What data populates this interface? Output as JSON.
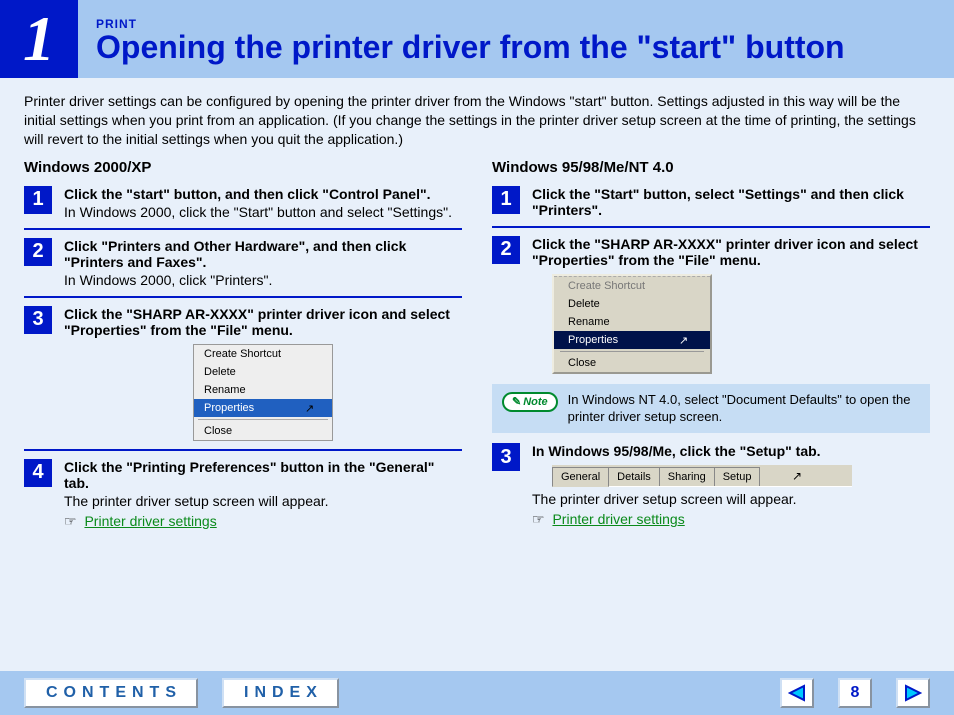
{
  "header": {
    "step_number": "1",
    "section_label": "PRINT",
    "title": "Opening the printer driver from the \"start\" button"
  },
  "intro_text": "Printer driver settings can be configured by opening the printer driver from the Windows \"start\" button. Settings adjusted in this way will be the initial settings when you print from an application. (If you change the settings in the printer driver setup screen at the time of printing, the settings will revert to the initial settings when you quit the application.)",
  "left_column": {
    "heading": "Windows 2000/XP",
    "steps": [
      {
        "num": "1",
        "title": "Click the \"start\" button, and then click \"Control Panel\".",
        "sub": "In Windows 2000, click the \"Start\" button and select \"Settings\"."
      },
      {
        "num": "2",
        "title": "Click \"Printers and Other Hardware\", and then click \"Printers and Faxes\".",
        "sub": "In Windows 2000, click \"Printers\"."
      },
      {
        "num": "3",
        "title": "Click the \"SHARP AR-XXXX\" printer driver icon and select \"Properties\" from the \"File\" menu.",
        "sub": ""
      },
      {
        "num": "4",
        "title": "Click the \"Printing Preferences\" button in the \"General\" tab.",
        "sub": "The printer driver setup screen will appear."
      }
    ],
    "link_text": "Printer driver settings",
    "context_menu": {
      "items": [
        "Create Shortcut",
        "Delete",
        "Rename",
        "Properties",
        "Close"
      ],
      "selected": "Properties"
    }
  },
  "right_column": {
    "heading": "Windows 95/98/Me/NT 4.0",
    "steps": [
      {
        "num": "1",
        "title": "Click the \"Start\" button, select \"Settings\" and then click \"Printers\"."
      },
      {
        "num": "2",
        "title": "Click the \"SHARP AR-XXXX\" printer driver icon and select \"Properties\" from the \"File\" menu."
      },
      {
        "num": "3",
        "title": "In Windows 95/98/Me, click the \"Setup\" tab.",
        "sub_after": "The printer driver setup screen will appear."
      }
    ],
    "context_menu": {
      "items": [
        "Create Shortcut",
        "Delete",
        "Rename",
        "Properties",
        "Close"
      ],
      "selected": "Properties"
    },
    "note_label": "Note",
    "note_text": "In Windows NT 4.0, select \"Document Defaults\" to open the printer driver setup screen.",
    "tabs": [
      "General",
      "Details",
      "Sharing",
      "Setup"
    ],
    "link_text": "Printer driver settings"
  },
  "footer": {
    "contents_label": "CONTENTS",
    "index_label": "INDEX",
    "page_number": "8"
  }
}
